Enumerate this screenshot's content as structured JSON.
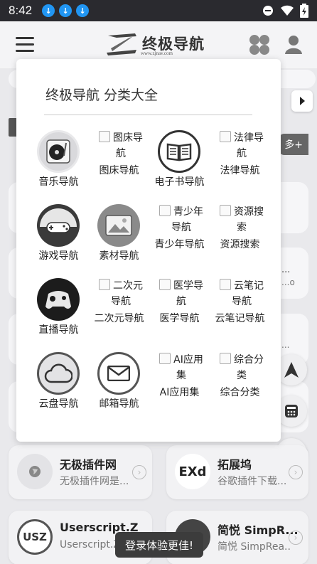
{
  "status_bar": {
    "time": "8:42"
  },
  "header": {
    "logo_text": "终极导航",
    "logo_url": "www.zjnav.com"
  },
  "background": {
    "more_label": "多+",
    "sites": [
      {
        "title": "无极插件网",
        "desc": "无极插件网是...",
        "logo": "globe-icon"
      },
      {
        "title": "拓展坞",
        "desc": "谷歌插件下载...",
        "logo": "EXd"
      },
      {
        "title": "Userscript.Z",
        "desc": "Userscript.Z",
        "logo": "USZ"
      },
      {
        "title": "简悦 SimpR...",
        "desc": "简悦 SimpRea...",
        "logo": ""
      }
    ],
    "peek_texts": [
      "...",
      "...o",
      "..."
    ]
  },
  "popup": {
    "title": "终极导航 分类大全",
    "rows": [
      [
        {
          "label": "音乐导航",
          "icon": "turntable-icon",
          "broken": false
        },
        {
          "label": "图床导航",
          "alt": "图床导航",
          "broken": true
        },
        {
          "label": "电子书导航",
          "icon": "book-icon",
          "broken": false
        },
        {
          "label": "法律导航",
          "alt": "法律导航",
          "broken": true
        }
      ],
      [
        {
          "label": "游戏导航",
          "icon": "gamepad-icon",
          "broken": false
        },
        {
          "label": "素材导航",
          "icon": "image-icon",
          "broken": false
        },
        {
          "label": "青少年导航",
          "alt": "青少年导航",
          "broken": true
        },
        {
          "label": "资源搜索",
          "alt": "资源搜索",
          "broken": true
        }
      ],
      [
        {
          "label": "直播导航",
          "icon": "controller-icon",
          "broken": false
        },
        {
          "label": "二次元导航",
          "alt": "二次元导航",
          "broken": true
        },
        {
          "label": "医学导航",
          "alt": "医学导航",
          "broken": true
        },
        {
          "label": "云笔记导航",
          "alt": "云笔记导航",
          "broken": true
        }
      ],
      [
        {
          "label": "云盘导航",
          "icon": "cloud-icon",
          "broken": false
        },
        {
          "label": "邮箱导航",
          "icon": "mail-icon",
          "broken": false
        },
        {
          "label": "AI应用集",
          "alt": "AI应用集",
          "broken": true
        },
        {
          "label": "综合分类",
          "alt": "综合分类",
          "broken": true
        }
      ]
    ]
  },
  "toast": {
    "text": "登录体验更佳!"
  }
}
